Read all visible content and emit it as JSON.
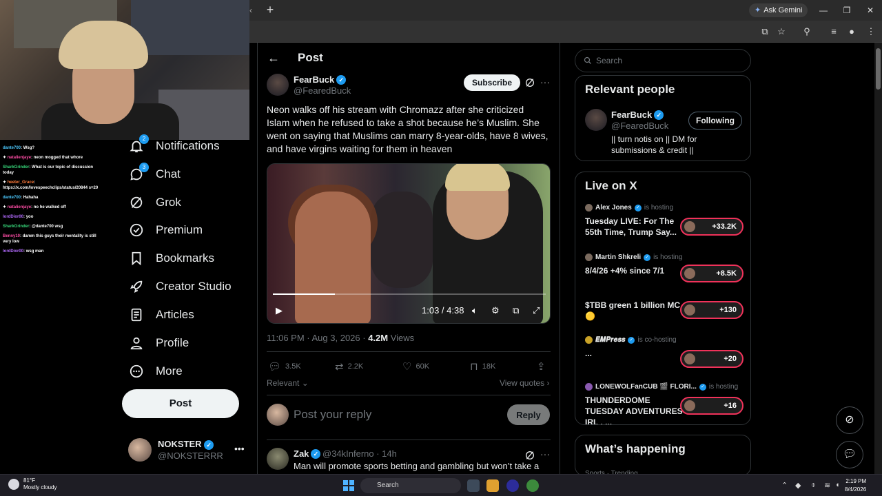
{
  "browser": {
    "ask_gemini": "Ask Gemini",
    "new_tab": "+"
  },
  "chat": [
    {
      "user": "dante700",
      "text": "Wsg?",
      "color": "#4cc9ff"
    },
    {
      "user": "natalienjaye",
      "text": "neon mogged that whore",
      "color": "#ff4da6"
    },
    {
      "user": "SharkGrinder",
      "text": "What is our topic of discussion today",
      "color": "#37d67a"
    },
    {
      "user": "heeter_Grace",
      "text": "https://x.com/lovespeechclips/status/20844 s=20",
      "color": "#ff7a3a"
    },
    {
      "user": "dante700",
      "text": "Hahaha",
      "color": "#4cc9ff"
    },
    {
      "user": "natalienjaye",
      "text": "no he walked off",
      "color": "#ff4da6"
    },
    {
      "user": "lordDior00",
      "text": "yoo",
      "color": "#b36bff"
    },
    {
      "user": "SharkGrinder",
      "text": "@dante700 wsg",
      "color": "#37d67a"
    },
    {
      "user": "Benny10",
      "text": "damm this guys their mentality is still very low",
      "color": "#ff4da6"
    },
    {
      "user": "lordDior00",
      "text": "wsg man",
      "color": "#b36bff"
    }
  ],
  "nav": {
    "items": [
      {
        "label": "Notifications",
        "icon": "bell-icon",
        "badge": "2"
      },
      {
        "label": "Chat",
        "icon": "chat-icon",
        "badge": "3"
      },
      {
        "label": "Grok",
        "icon": "grok-icon"
      },
      {
        "label": "Premium",
        "icon": "premium-icon"
      },
      {
        "label": "Bookmarks",
        "icon": "bookmark-icon"
      },
      {
        "label": "Creator Studio",
        "icon": "rocket-icon"
      },
      {
        "label": "Articles",
        "icon": "articles-icon"
      },
      {
        "label": "Profile",
        "icon": "profile-icon"
      },
      {
        "label": "More",
        "icon": "more-circle-icon"
      }
    ],
    "post_button": "Post",
    "account": {
      "name": "NOKSTER",
      "handle": "@NOKSTERRR"
    }
  },
  "post": {
    "page_title": "Post",
    "author": {
      "name": "FearBuck",
      "handle": "@FearedBuck"
    },
    "subscribe": "Subscribe",
    "text": "Neon walks off his stream with Chromazz after she criticized Islam when he refused to take a shot because he’s Muslim. She went on saying that Muslims can marry 8-year-olds, have 8 wives, and have virgins waiting for them in heaven",
    "video": {
      "time": "1:03 / 4:38",
      "progress": 0.227
    },
    "meta_time": "11:06 PM · Aug 3, 2026 · ",
    "views_count": "4.2M",
    "views_label": " Views",
    "stats": {
      "replies": "3.5K",
      "reposts": "2.2K",
      "likes": "60K",
      "bookmarks": "18K"
    },
    "relevant": "Relevant",
    "view_quotes": "View quotes",
    "reply_placeholder": "Post your reply",
    "reply_button": "Reply"
  },
  "comment": {
    "name": "Zak",
    "handle": "@34kInferno · 14h",
    "text": "Man will promote sports betting and gambling but won’t take a"
  },
  "sidebar": {
    "search_placeholder": "Search",
    "relevant_people": {
      "title": "Relevant people",
      "name": "FearBuck",
      "handle": "@FearedBuck",
      "bio": "|| turn notis on || DM for submissions & credit ||",
      "button": "Following"
    },
    "live": {
      "title": "Live on X",
      "items": [
        {
          "host": "Alex Jones",
          "status": "is hosting",
          "title": "Tuesday LIVE: For The 55th Time, Trump Say...",
          "count": "+33.2K"
        },
        {
          "host": "Martin Shkreli",
          "status": "is hosting",
          "title": "8/4/26 +4% since 7/1",
          "count": "+8.5K"
        },
        {
          "host": "",
          "status": "",
          "title": "$TBB green 1 billion MC 🟡",
          "count": "+130"
        },
        {
          "host": "𝑬𝑴𝑷𝒓𝒆𝒔𝒔",
          "status": "is co-hosting",
          "title": "...",
          "count": "+20"
        },
        {
          "host": "LONEWOLFanCUB 🎬 FLORI...",
          "status": "is hosting",
          "title": "THUNDERDOME TUESDAY ADVENTURES : IRL , ...",
          "count": "+16"
        }
      ]
    },
    "happening": {
      "title": "What’s happening",
      "sub": "Sports · Trending"
    }
  },
  "taskbar": {
    "temp": "81°F",
    "weather": "Mostly cloudy",
    "search": "Search",
    "time": "2:19 PM",
    "date": "8/4/2026"
  }
}
